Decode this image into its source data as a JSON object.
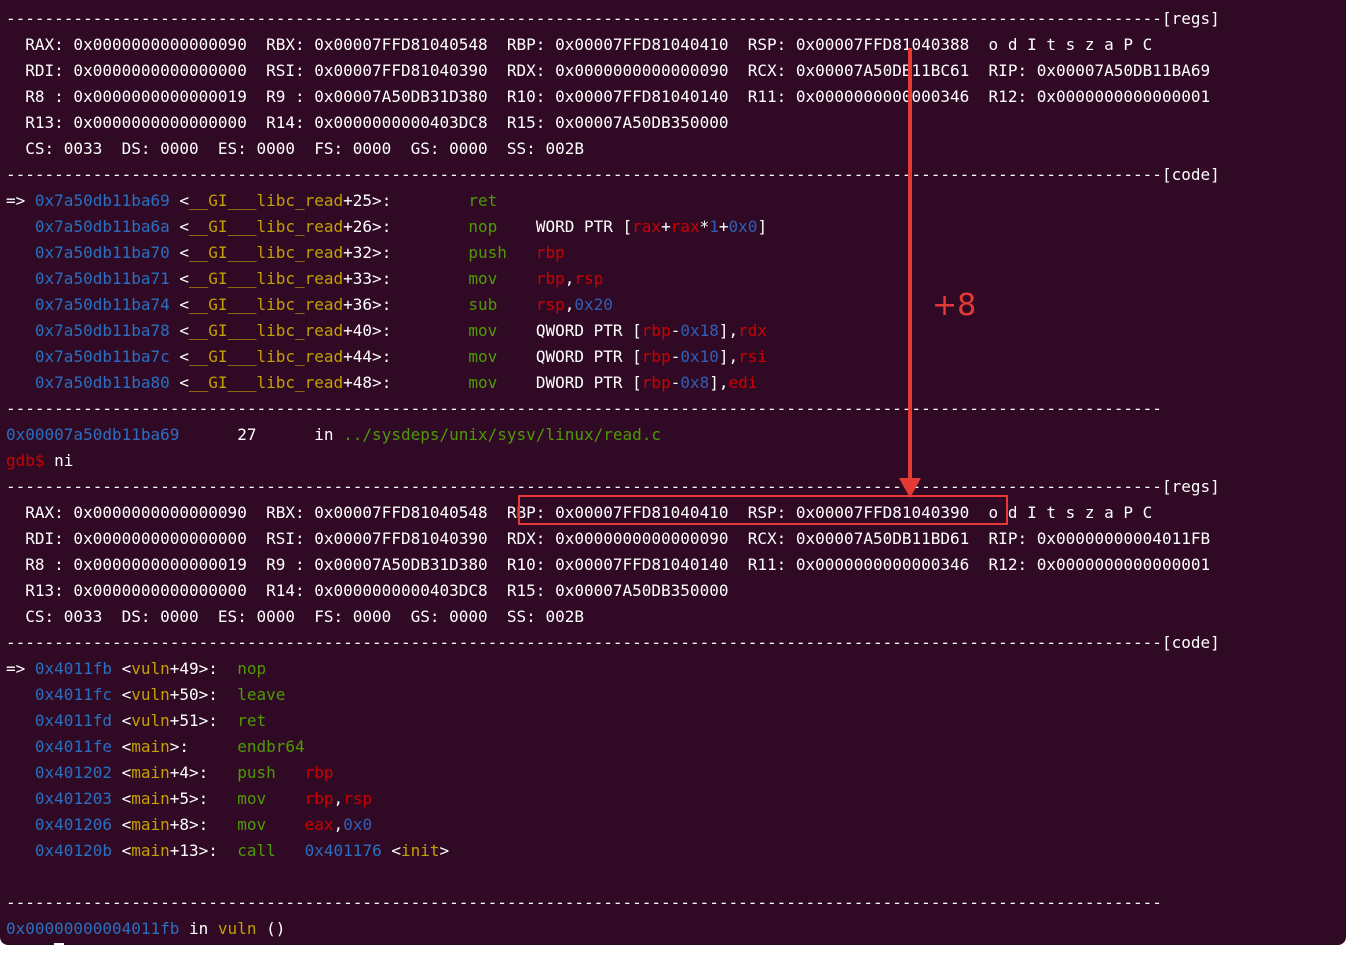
{
  "colors": {
    "background": "#300a24",
    "address": "#2a6fc1",
    "mnemonic": "#4e9a06",
    "register": "#cc0000",
    "immediate": "#2f5fb8",
    "annotation": "#e53935"
  },
  "lines": [
    [
      [
        "------------------------------------------------------------------------------------------------------------------------[regs]",
        ""
      ]
    ],
    [
      [
        "  RAX: 0x0000000000000090  RBX: 0x00007FFD81040548  RBP: 0x00007FFD81040410  RSP: 0x00007FFD81040388  o d I t s z a P C",
        ""
      ]
    ],
    [
      [
        "  RDI: 0x0000000000000000  RSI: 0x00007FFD81040390  RDX: 0x0000000000000090  RCX: 0x00007A50DB11BC61  RIP: 0x00007A50DB11BA69",
        ""
      ]
    ],
    [
      [
        "  R8 : 0x0000000000000019  R9 : 0x00007A50DB31D380  R10: 0x00007FFD81040140  R11: 0x0000000000000346  R12: 0x0000000000000001",
        ""
      ]
    ],
    [
      [
        "  R13: 0x0000000000000000  R14: 0x0000000000403DC8  R15: 0x00007A50DB350000",
        ""
      ]
    ],
    [
      [
        "  CS: 0033  DS: 0000  ES: 0000  FS: 0000  GS: 0000  SS: 002B",
        ""
      ]
    ],
    [
      [
        "------------------------------------------------------------------------------------------------------------------------[code]",
        ""
      ]
    ],
    [
      [
        "=> ",
        ""
      ],
      [
        "0x7a50db11ba69",
        "c-addr"
      ],
      [
        " <",
        ""
      ],
      [
        "__GI___libc_read",
        "c-yellow"
      ],
      [
        "+25>:        ",
        ""
      ],
      [
        "ret",
        "c-green"
      ]
    ],
    [
      [
        "   ",
        ""
      ],
      [
        "0x7a50db11ba6a",
        "c-addr"
      ],
      [
        " <",
        ""
      ],
      [
        "__GI___libc_read",
        "c-yellow"
      ],
      [
        "+26>:        ",
        ""
      ],
      [
        "nop",
        "c-green"
      ],
      [
        "    WORD PTR [",
        ""
      ],
      [
        "rax",
        "c-red"
      ],
      [
        "+",
        ""
      ],
      [
        "rax",
        "c-red"
      ],
      [
        "*",
        ""
      ],
      [
        "1",
        "c-blue"
      ],
      [
        "+",
        ""
      ],
      [
        "0x0",
        "c-blue"
      ],
      [
        "]",
        ""
      ]
    ],
    [
      [
        "   ",
        ""
      ],
      [
        "0x7a50db11ba70",
        "c-addr"
      ],
      [
        " <",
        ""
      ],
      [
        "__GI___libc_read",
        "c-yellow"
      ],
      [
        "+32>:        ",
        ""
      ],
      [
        "push",
        "c-green"
      ],
      [
        "   ",
        ""
      ],
      [
        "rbp",
        "c-red"
      ]
    ],
    [
      [
        "   ",
        ""
      ],
      [
        "0x7a50db11ba71",
        "c-addr"
      ],
      [
        " <",
        ""
      ],
      [
        "__GI___libc_read",
        "c-yellow"
      ],
      [
        "+33>:        ",
        ""
      ],
      [
        "mov",
        "c-green"
      ],
      [
        "    ",
        ""
      ],
      [
        "rbp",
        "c-red"
      ],
      [
        ",",
        ""
      ],
      [
        "rsp",
        "c-red"
      ]
    ],
    [
      [
        "   ",
        ""
      ],
      [
        "0x7a50db11ba74",
        "c-addr"
      ],
      [
        " <",
        ""
      ],
      [
        "__GI___libc_read",
        "c-yellow"
      ],
      [
        "+36>:        ",
        ""
      ],
      [
        "sub",
        "c-green"
      ],
      [
        "    ",
        ""
      ],
      [
        "rsp",
        "c-red"
      ],
      [
        ",",
        ""
      ],
      [
        "0x20",
        "c-blue"
      ]
    ],
    [
      [
        "   ",
        ""
      ],
      [
        "0x7a50db11ba78",
        "c-addr"
      ],
      [
        " <",
        ""
      ],
      [
        "__GI___libc_read",
        "c-yellow"
      ],
      [
        "+40>:        ",
        ""
      ],
      [
        "mov",
        "c-green"
      ],
      [
        "    QWORD PTR [",
        ""
      ],
      [
        "rbp",
        "c-red"
      ],
      [
        "-",
        ""
      ],
      [
        "0x18",
        "c-blue"
      ],
      [
        "],",
        ""
      ],
      [
        "rdx",
        "c-red"
      ]
    ],
    [
      [
        "   ",
        ""
      ],
      [
        "0x7a50db11ba7c",
        "c-addr"
      ],
      [
        " <",
        ""
      ],
      [
        "__GI___libc_read",
        "c-yellow"
      ],
      [
        "+44>:        ",
        ""
      ],
      [
        "mov",
        "c-green"
      ],
      [
        "    QWORD PTR [",
        ""
      ],
      [
        "rbp",
        "c-red"
      ],
      [
        "-",
        ""
      ],
      [
        "0x10",
        "c-blue"
      ],
      [
        "],",
        ""
      ],
      [
        "rsi",
        "c-red"
      ]
    ],
    [
      [
        "   ",
        ""
      ],
      [
        "0x7a50db11ba80",
        "c-addr"
      ],
      [
        " <",
        ""
      ],
      [
        "__GI___libc_read",
        "c-yellow"
      ],
      [
        "+48>:        ",
        ""
      ],
      [
        "mov",
        "c-green"
      ],
      [
        "    DWORD PTR [",
        ""
      ],
      [
        "rbp",
        "c-red"
      ],
      [
        "-",
        ""
      ],
      [
        "0x8",
        "c-blue"
      ],
      [
        "],",
        ""
      ],
      [
        "edi",
        "c-red"
      ]
    ],
    [
      [
        "------------------------------------------------------------------------------------------------------------------------",
        ""
      ]
    ],
    [
      [
        "0x00007a50db11ba69",
        "c-addr"
      ],
      [
        "      27      in ",
        ""
      ],
      [
        "../sysdeps/unix/sysv/linux/read.c",
        "c-green"
      ]
    ],
    [
      [
        "gdb$",
        "c-prompt"
      ],
      [
        " ni",
        ""
      ]
    ],
    [
      [
        "------------------------------------------------------------------------------------------------------------------------[regs]",
        ""
      ]
    ],
    [
      [
        "  RAX: 0x0000000000000090  RBX: 0x00007FFD81040548  RBP: 0x00007FFD81040410  RSP: 0x00007FFD81040390  o d I t s z a P C",
        ""
      ]
    ],
    [
      [
        "  RDI: 0x0000000000000000  RSI: 0x00007FFD81040390  RDX: 0x0000000000000090  RCX: 0x00007A50DB11BD61  RIP: 0x00000000004011FB",
        ""
      ]
    ],
    [
      [
        "  R8 : 0x0000000000000019  R9 : 0x00007A50DB31D380  R10: 0x00007FFD81040140  R11: 0x0000000000000346  R12: 0x0000000000000001",
        ""
      ]
    ],
    [
      [
        "  R13: 0x0000000000000000  R14: 0x0000000000403DC8  R15: 0x00007A50DB350000",
        ""
      ]
    ],
    [
      [
        "  CS: 0033  DS: 0000  ES: 0000  FS: 0000  GS: 0000  SS: 002B",
        ""
      ]
    ],
    [
      [
        "------------------------------------------------------------------------------------------------------------------------[code]",
        ""
      ]
    ],
    [
      [
        "=> ",
        ""
      ],
      [
        "0x4011fb",
        "c-addr"
      ],
      [
        " <",
        ""
      ],
      [
        "vuln",
        "c-yellow"
      ],
      [
        "+49>:  ",
        ""
      ],
      [
        "nop",
        "c-green"
      ]
    ],
    [
      [
        "   ",
        ""
      ],
      [
        "0x4011fc",
        "c-addr"
      ],
      [
        " <",
        ""
      ],
      [
        "vuln",
        "c-yellow"
      ],
      [
        "+50>:  ",
        ""
      ],
      [
        "leave",
        "c-green"
      ]
    ],
    [
      [
        "   ",
        ""
      ],
      [
        "0x4011fd",
        "c-addr"
      ],
      [
        " <",
        ""
      ],
      [
        "vuln",
        "c-yellow"
      ],
      [
        "+51>:  ",
        ""
      ],
      [
        "ret",
        "c-green"
      ]
    ],
    [
      [
        "   ",
        ""
      ],
      [
        "0x4011fe",
        "c-addr"
      ],
      [
        " <",
        ""
      ],
      [
        "main",
        "c-yellow"
      ],
      [
        ">:     ",
        ""
      ],
      [
        "endbr64",
        "c-green"
      ]
    ],
    [
      [
        "   ",
        ""
      ],
      [
        "0x401202",
        "c-addr"
      ],
      [
        " <",
        ""
      ],
      [
        "main",
        "c-yellow"
      ],
      [
        "+4>:   ",
        ""
      ],
      [
        "push",
        "c-green"
      ],
      [
        "   ",
        ""
      ],
      [
        "rbp",
        "c-red"
      ]
    ],
    [
      [
        "   ",
        ""
      ],
      [
        "0x401203",
        "c-addr"
      ],
      [
        " <",
        ""
      ],
      [
        "main",
        "c-yellow"
      ],
      [
        "+5>:   ",
        ""
      ],
      [
        "mov",
        "c-green"
      ],
      [
        "    ",
        ""
      ],
      [
        "rbp",
        "c-red"
      ],
      [
        ",",
        ""
      ],
      [
        "rsp",
        "c-red"
      ]
    ],
    [
      [
        "   ",
        ""
      ],
      [
        "0x401206",
        "c-addr"
      ],
      [
        " <",
        ""
      ],
      [
        "main",
        "c-yellow"
      ],
      [
        "+8>:   ",
        ""
      ],
      [
        "mov",
        "c-green"
      ],
      [
        "    ",
        ""
      ],
      [
        "eax",
        "c-red"
      ],
      [
        ",",
        ""
      ],
      [
        "0x0",
        "c-blue"
      ]
    ],
    [
      [
        "   ",
        ""
      ],
      [
        "0x40120b",
        "c-addr"
      ],
      [
        " <",
        ""
      ],
      [
        "main",
        "c-yellow"
      ],
      [
        "+13>:  ",
        ""
      ],
      [
        "call",
        "c-green"
      ],
      [
        "   ",
        ""
      ],
      [
        "0x401176",
        "c-addr"
      ],
      [
        " <",
        ""
      ],
      [
        "init",
        "c-yellow"
      ],
      [
        ">",
        ""
      ]
    ],
    [
      [
        "",
        ""
      ]
    ],
    [
      [
        "------------------------------------------------------------------------------------------------------------------------",
        ""
      ]
    ],
    [
      [
        "0x00000000004011fb",
        "c-addr"
      ],
      [
        " in ",
        ""
      ],
      [
        "vuln",
        "c-yellow"
      ],
      [
        " ()",
        ""
      ]
    ],
    [
      [
        "gdb$",
        "c-prompt"
      ],
      [
        " ",
        ""
      ]
    ]
  ],
  "annotation": {
    "label": "+8"
  }
}
